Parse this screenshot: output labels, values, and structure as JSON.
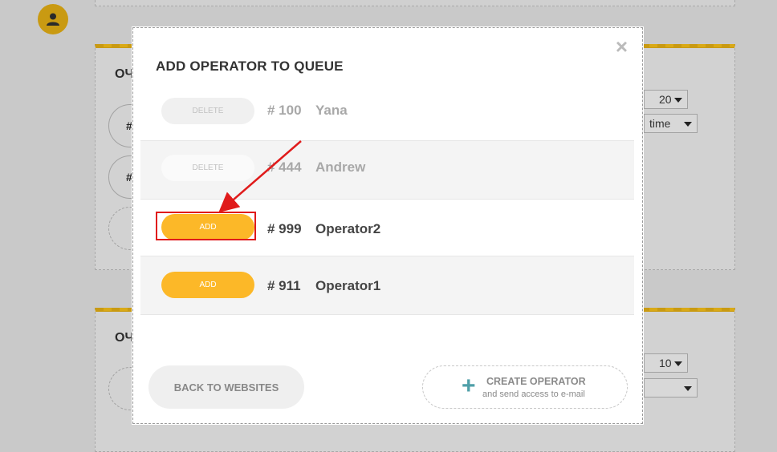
{
  "background": {
    "card_label_1": "ОЧ",
    "card_label_2": "ОЧ",
    "hash": "#",
    "select_count_1": "20",
    "select_sort_1": "time",
    "select_count_2": "10"
  },
  "modal": {
    "title": "ADD OPERATOR TO QUEUE",
    "close_glyph": "×",
    "operators": [
      {
        "action": "DELETE",
        "number": "# 100",
        "name": "Yana"
      },
      {
        "action": "DELETE",
        "number": "# 444",
        "name": "Andrew"
      },
      {
        "action": "ADD",
        "number": "# 999",
        "name": "Operator2"
      },
      {
        "action": "ADD",
        "number": "# 911",
        "name": "Operator1"
      }
    ],
    "back_label": "BACK TO WEBSITES",
    "create_label": "CREATE OPERATOR",
    "create_sub": "and send access to e-mail",
    "create_icon": "plus-icon"
  },
  "colors": {
    "accent": "#fcb828",
    "annotation": "#e01b1b",
    "teal": "#4f9fa8"
  }
}
